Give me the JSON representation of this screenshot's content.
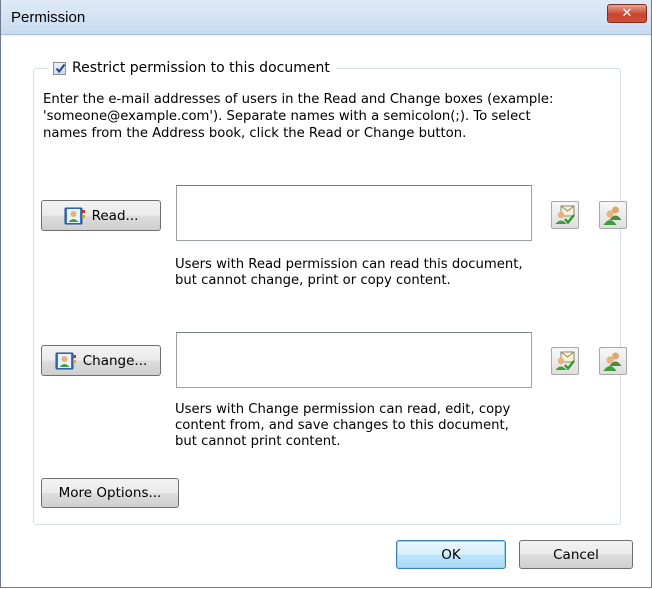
{
  "window": {
    "title": "Permission",
    "close_glyph": "✕"
  },
  "restrict": {
    "label": "Restrict permission to this document",
    "checked": true
  },
  "description": "Enter the e-mail addresses of users in the Read and Change boxes (example:\n'someone@example.com'). Separate names with a semicolon(;). To select\nnames from the Address book, click the Read or Change button.",
  "read": {
    "button_label": "Read...",
    "value": "",
    "note": "Users with Read permission can read this document,\nbut cannot change, print or copy content."
  },
  "change": {
    "button_label": "Change...",
    "value": "",
    "note": "Users with Change permission can read, edit, copy\ncontent from, and save changes to this document,\nbut cannot print content."
  },
  "more_options_label": "More Options...",
  "ok_label": "OK",
  "cancel_label": "Cancel",
  "icons": {
    "address_book": "address-book-icon",
    "check_names": "check-names-icon",
    "users": "users-icon"
  }
}
